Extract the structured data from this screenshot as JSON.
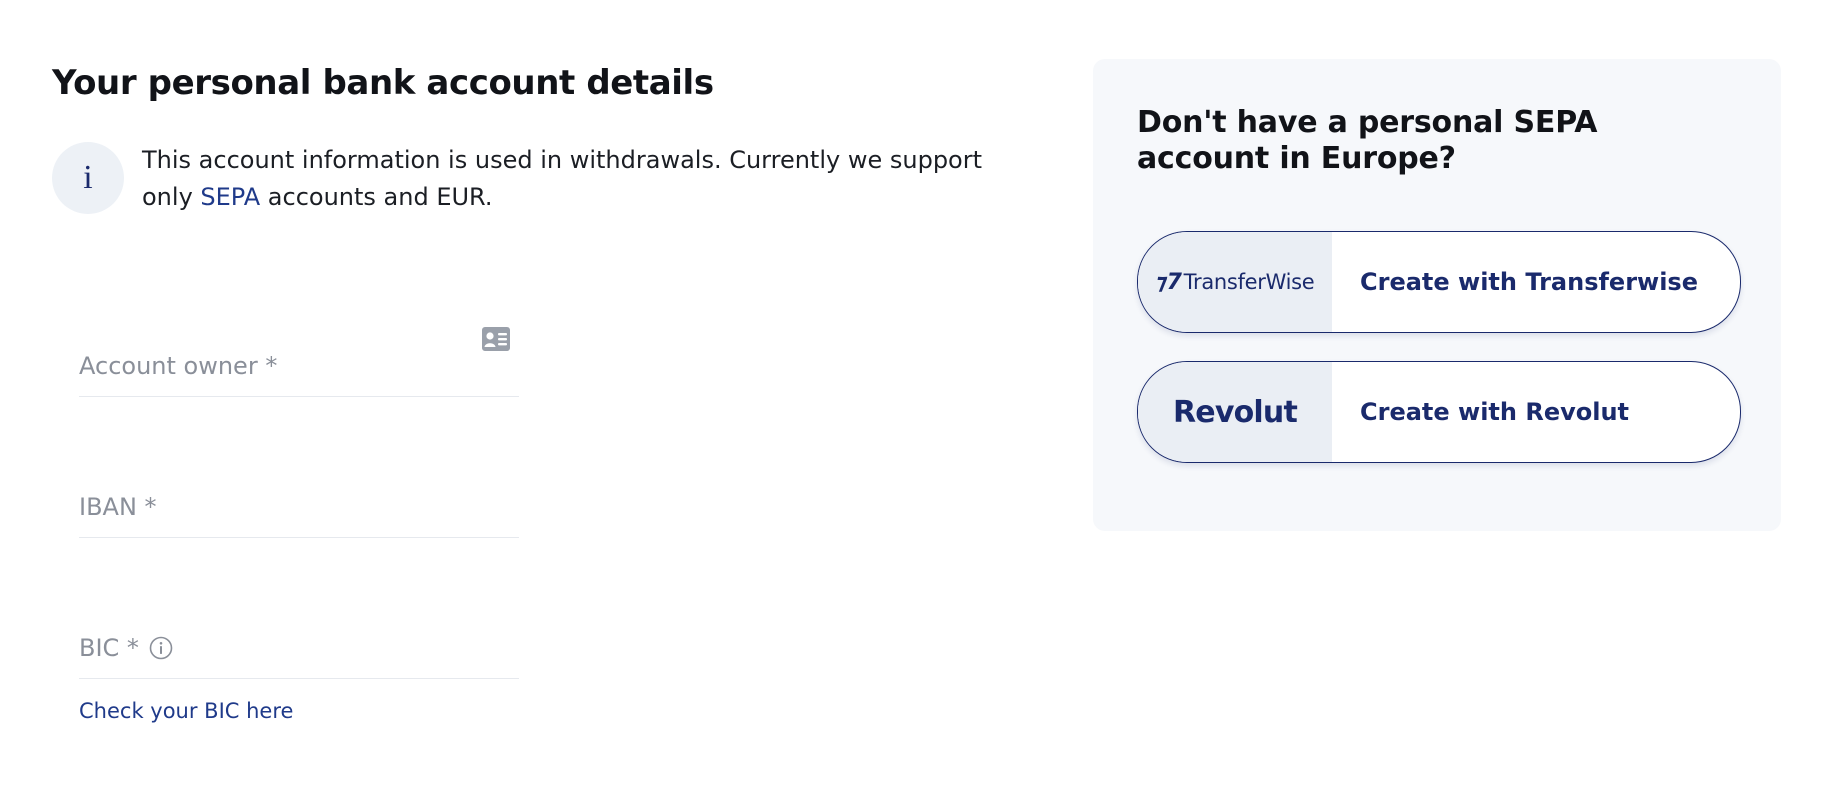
{
  "header": {
    "title": "Your personal bank account details"
  },
  "info": {
    "icon": "info-icon",
    "glyph": "i",
    "text_before_link": "This account information is used in withdrawals. Currently we support only ",
    "link_text": "SEPA",
    "text_after_link": " accounts and EUR."
  },
  "form": {
    "account_owner": {
      "label": "Account owner *",
      "value": "",
      "icon": "contact-card-icon"
    },
    "iban": {
      "label": "IBAN *",
      "value": ""
    },
    "bic": {
      "label": "BIC *",
      "value": "",
      "icon": "info-circle-icon",
      "help_link": "Check your BIC here"
    }
  },
  "panel": {
    "title": "Don't have a personal SEPA account in Europe?",
    "providers": [
      {
        "logo_mark": "⁊7",
        "logo_text": "TransferWise",
        "label": "Create with Transferwise"
      },
      {
        "logo_text": "Revolut",
        "label": "Create with Revolut"
      }
    ]
  },
  "colors": {
    "accent": "#1a2a6c",
    "link": "#1f3a8a",
    "muted_text": "#8a8f99",
    "panel_bg": "#f6f8fb",
    "badge_bg": "#edf1f6"
  }
}
